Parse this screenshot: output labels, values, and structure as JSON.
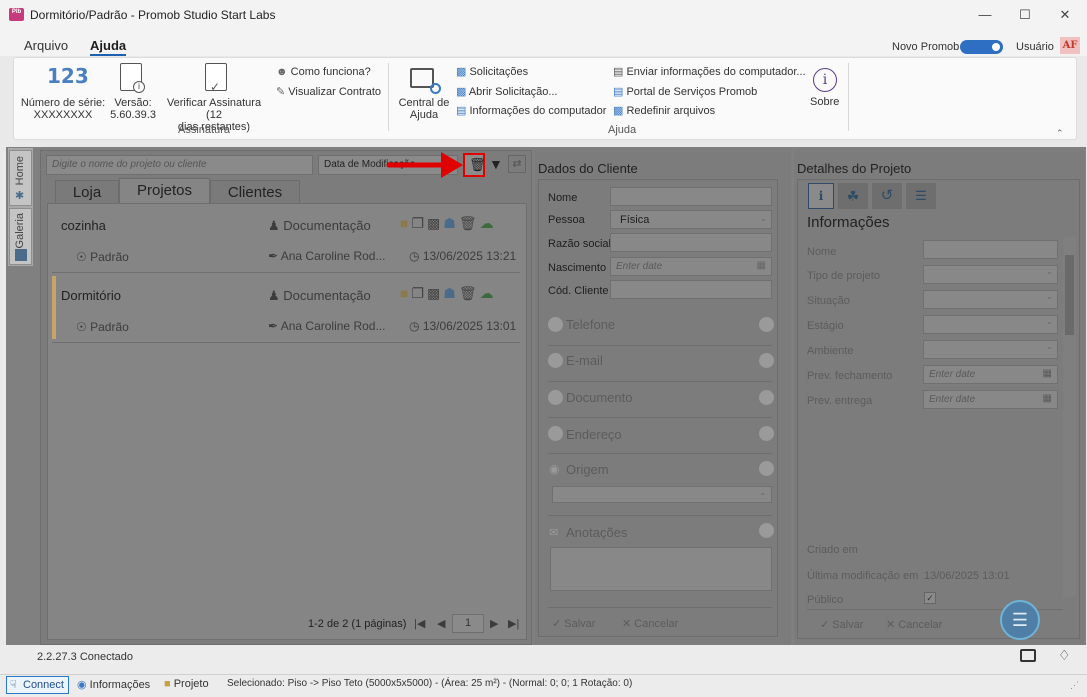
{
  "window": {
    "title": "Dormitório/Padrão - Promob Studio Start Labs",
    "icon_text": "Plb"
  },
  "menu": {
    "arquivo": "Arquivo",
    "ajuda": "Ajuda"
  },
  "topright": {
    "novo_promob": "Novo Promob",
    "usuario": "Usuário",
    "avatar": "AF"
  },
  "ribbon": {
    "numero_serie": "Número de série:",
    "serie_value": "XXXXXXXX",
    "versao": "Versão:",
    "versao_value": "5.60.39.3",
    "verificar": "Verificar Assinatura (12",
    "verificar2": "dias restantes)",
    "como_funciona": "Como funciona?",
    "visualizar_contrato": "Visualizar Contrato",
    "group_assinatura": "Assinatura",
    "central": "Central de",
    "central2": "Ajuda",
    "solicitacoes": "Solicitações",
    "abrir_solicitacao": "Abrir Solicitação...",
    "info_computador": "Informações do computador",
    "enviar_info": "Enviar informações do computador...",
    "portal": "Portal de Serviços Promob",
    "redefinir": "Redefinir arquivos",
    "sobre": "Sobre",
    "group_ajuda": "Ajuda"
  },
  "sidetabs": {
    "home": "Home",
    "galeria": "Galeria"
  },
  "projects": {
    "search_placeholder": "Digite o nome do projeto ou cliente",
    "sort_label": "Data de Modificação",
    "tabs": [
      "Loja",
      "Projetos",
      "Clientes"
    ],
    "items": [
      {
        "name": "cozinha",
        "variant": "Padrão",
        "doc": "Documentação",
        "author": "Ana Caroline Rod...",
        "date": "13/06/2025 13:21"
      },
      {
        "name": "Dormitório",
        "variant": "Padrão",
        "doc": "Documentação",
        "author": "Ana Caroline Rod...",
        "date": "13/06/2025 13:01"
      }
    ],
    "pagination": "1-2 de 2 (1 páginas)",
    "page": "1"
  },
  "cliente": {
    "title": "Dados do Cliente",
    "nome": "Nome",
    "pessoa": "Pessoa",
    "pessoa_value": "Física",
    "razao": "Razão social",
    "nascimento": "Nascimento",
    "nascimento_ph": "Enter date",
    "cod": "Cód. Cliente",
    "telefone": "Telefone",
    "email": "E-mail",
    "documento": "Documento",
    "endereco": "Endereço",
    "origem": "Origem",
    "anotacoes": "Anotações",
    "salvar": "Salvar",
    "cancelar": "Cancelar"
  },
  "detalhes": {
    "title": "Detalhes do Projeto",
    "informacoes": "Informações",
    "nome": "Nome",
    "tipo": "Tipo de projeto",
    "situacao": "Situação",
    "estagio": "Estágio",
    "ambiente": "Ambiente",
    "prev_fechamento": "Prev. fechamento",
    "prev_entrega": "Prev. entrega",
    "enter_date": "Enter date",
    "criado": "Criado em",
    "ultima": "Última modificação em",
    "ultima_value": "13/06/2025 13:01",
    "publico": "Público",
    "salvar": "Salvar",
    "cancelar": "Cancelar"
  },
  "version_status": "2.2.27.3 Conectado",
  "statusbar": {
    "connect": "Connect",
    "informacoes": "Informações",
    "projeto": "Projeto",
    "selecionado": "Selecionado: Piso -> Piso Teto (5000x5x5000) - (Área: 25 m²) - (Normal: 0; 0; 1 Rotação: 0)"
  },
  "colors": {
    "accent": "#2f6fc3",
    "highlight": "#e00000",
    "arrow": "#e00000",
    "dormitorio_marker": "#c9a46a"
  }
}
